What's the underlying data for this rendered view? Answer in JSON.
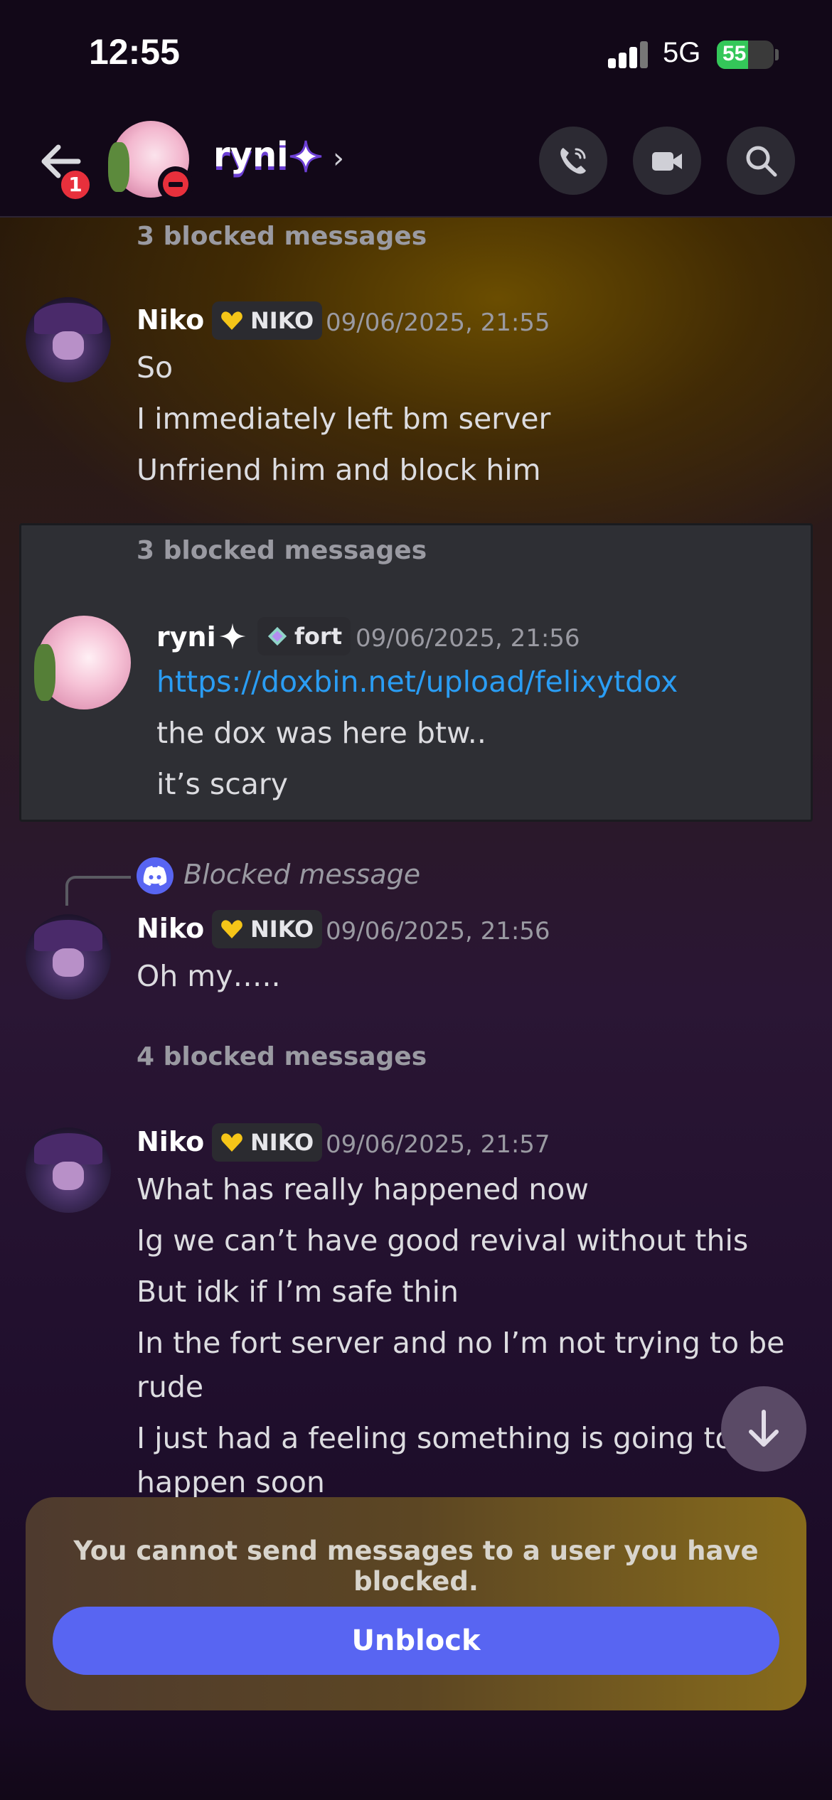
{
  "status_bar": {
    "time": "12:55",
    "network": "5G",
    "battery": "55"
  },
  "header": {
    "back_badge": "1",
    "contact_name": "ryni"
  },
  "messages": {
    "blocked_1": "3 blocked messages",
    "group1": {
      "username": "Niko",
      "role": "NIKO",
      "timestamp": "09/06/2025, 21:55",
      "lines": [
        "So",
        "I immediately left bm server",
        "Unfriend him and block him"
      ]
    },
    "blocked_2": "3 blocked messages",
    "group2": {
      "username": "ryni",
      "role": "fort",
      "timestamp": "09/06/2025, 21:56",
      "link": "https://doxbin.net/upload/felixytdox",
      "lines": [
        "the dox was here btw..",
        "it’s scary"
      ]
    },
    "reply_preview": "Blocked message",
    "group3": {
      "username": "Niko",
      "role": "NIKO",
      "timestamp": "09/06/2025, 21:56",
      "lines": [
        "Oh my….."
      ]
    },
    "blocked_3": "4 blocked messages",
    "group4": {
      "username": "Niko",
      "role": "NIKO",
      "timestamp": "09/06/2025, 21:57",
      "lines": [
        "What has really happened now",
        "Ig we can’t have good revival without this",
        "But idk if I’m safe thin",
        "In the fort server and no I’m not trying to be",
        "rude",
        "I just had a feeling something is going to",
        "happen soon"
      ]
    }
  },
  "blocked_panel": {
    "notice": "You cannot send messages to a user you have blocked.",
    "unblock_label": "Unblock"
  },
  "colors": {
    "accent": "#5865f2",
    "link": "#2a9df4",
    "blocked_badge": "#e8303c",
    "battery": "#34c759"
  },
  "icons": [
    "back-arrow-icon",
    "sparkle-icon",
    "chevron-right-icon",
    "phone-icon",
    "video-icon",
    "search-icon",
    "heart-icon",
    "discord-icon",
    "arrow-down-icon"
  ]
}
